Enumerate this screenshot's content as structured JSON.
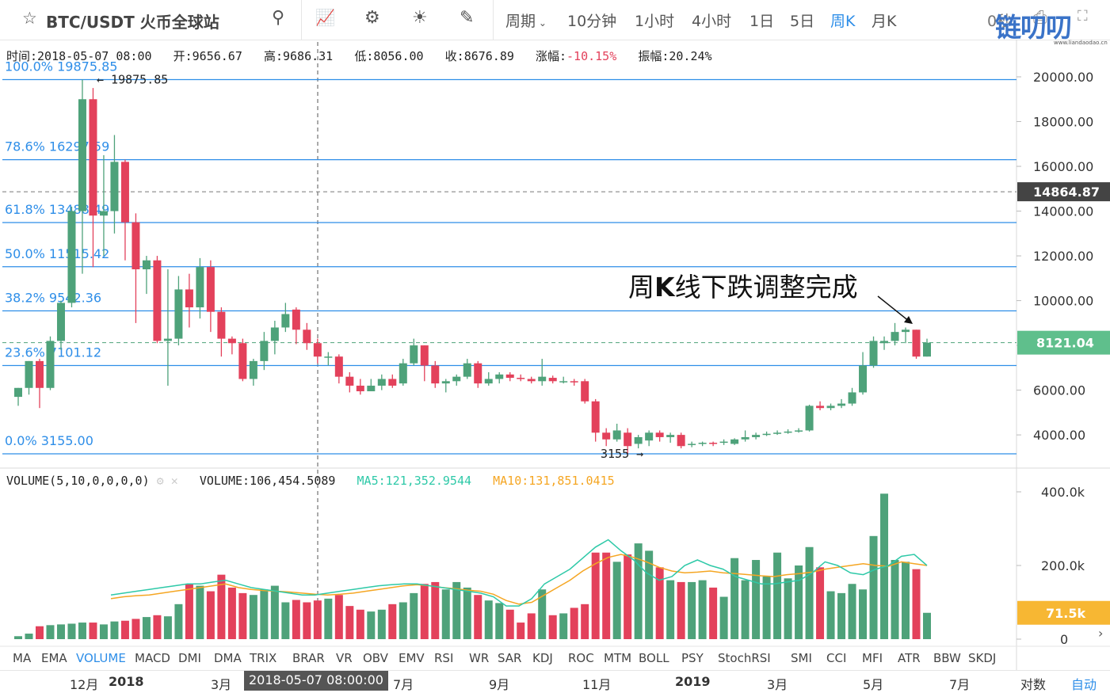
{
  "header": {
    "pair": "BTC/USDT 火币全球站",
    "icons": [
      "search-icon",
      "indicator-icon",
      "settings-icon",
      "theme-icon",
      "draw-icon",
      "screenshot-icon",
      "fullscreen-icon"
    ],
    "periods": [
      "周期",
      "10分钟",
      "1小时",
      "4小时",
      "1日",
      "5日",
      "周K",
      "月K"
    ],
    "active_period": "周K",
    "countdown": "0秒"
  },
  "info": {
    "time_label": "时间:",
    "time": "2018-05-07 08:00",
    "open_label": "开:",
    "open": "9656.67",
    "high_label": "高:",
    "high": "9686.31",
    "low_label": "低:",
    "low": "8056.00",
    "close_label": "收:",
    "close": "8676.89",
    "change_label": "涨幅:",
    "change": "-10.15%",
    "amplitude_label": "振幅:",
    "amplitude": "20.24%"
  },
  "volume_info": {
    "title": "VOLUME(5,10,0,0,0,0)",
    "volume": "VOLUME:106,454.5089",
    "ma5": "MA5:121,352.9544",
    "ma10": "MA10:131,851.0415"
  },
  "indicators": [
    "MA",
    "EMA",
    "VOLUME",
    "MACD",
    "DMI",
    "DMA",
    "TRIX",
    "BRAR",
    "VR",
    "OBV",
    "EMV",
    "RSI",
    "WR",
    "SAR",
    "KDJ",
    "ROC",
    "MTM",
    "BOLL",
    "PSY",
    "StochRSI",
    "SMI",
    "CCI",
    "MFI",
    "ATR",
    "BBW",
    "SKDJ"
  ],
  "active_indicator": "VOLUME",
  "time_axis": {
    "labels": [
      "12月",
      "2018",
      "3月",
      "7月",
      "9月",
      "11月",
      "2019",
      "3月",
      "5月",
      "7月"
    ],
    "crosshair_time": "2018-05-07 08:00:00",
    "log_button": "对数",
    "auto_button": "自动"
  },
  "watermark": {
    "text": "链叨叨",
    "sub": "www.liandaodao.cn"
  },
  "annotation": {
    "pre": "周",
    "bold": "K",
    "post": "线下跌调整完成"
  },
  "colors": {
    "up": "#4ea27a",
    "down": "#e3415b",
    "fib": "#2e8ee8",
    "ma5": "#2ec9a8",
    "ma10": "#f5a623",
    "price_tag": "#5fbf8c"
  },
  "chart_data": [
    {
      "type": "candlestick",
      "interval": "1 week",
      "ylim": [
        3155,
        20000
      ],
      "yticks": [
        4000,
        6000,
        8000,
        10000,
        12000,
        14000,
        16000,
        18000,
        20000
      ],
      "ytick_labels": [
        "4000.00",
        "6000.00",
        "8000.00",
        "10000.00",
        "12000.00",
        "14000.00",
        "16000.00",
        "18000.00",
        "20000.00"
      ],
      "last_price": "8121.04",
      "crosshair_price": "14864.87",
      "high_marker": "19875.85",
      "low_marker": "3155",
      "fib_levels": [
        {
          "label": "100.0% 19875.85",
          "value": 19875.85
        },
        {
          "label": "78.6% 16297.59",
          "value": 16297.59
        },
        {
          "label": "61.8% 13488.49",
          "value": 13488.49
        },
        {
          "label": "50.0% 11515.42",
          "value": 11515.42
        },
        {
          "label": "38.2% 9542.36",
          "value": 9542.36
        },
        {
          "label": "23.6% 7101.12",
          "value": 7101.12
        },
        {
          "label": "0.0% 3155.00",
          "value": 3155.0
        }
      ],
      "candles": [
        [
          5700,
          6100,
          5300,
          6100
        ],
        [
          6100,
          7300,
          5800,
          7300
        ],
        [
          7300,
          6100,
          5200,
          7400
        ],
        [
          6100,
          8200,
          6000,
          8400
        ],
        [
          8200,
          9900,
          7800,
          10000
        ],
        [
          9900,
          14000,
          9700,
          14200
        ],
        [
          14000,
          19000,
          11200,
          19875.85
        ],
        [
          19000,
          13800,
          11500,
          19500
        ],
        [
          13800,
          14000,
          12000,
          16500
        ],
        [
          14000,
          16200,
          13000,
          17400
        ],
        [
          16200,
          13500,
          11800,
          16300
        ],
        [
          13500,
          11400,
          9000,
          13900
        ],
        [
          11400,
          11800,
          10300,
          12000
        ],
        [
          11800,
          8200,
          8100,
          12000
        ],
        [
          8200,
          8300,
          6200,
          11400
        ],
        [
          8300,
          10500,
          8000,
          11100
        ],
        [
          10500,
          9700,
          8800,
          11200
        ],
        [
          9700,
          11500,
          9200,
          11900
        ],
        [
          11500,
          9500,
          8600,
          11800
        ],
        [
          9500,
          8300,
          7500,
          9700
        ],
        [
          8300,
          8100,
          7600,
          8400
        ],
        [
          8100,
          6500,
          6400,
          8300
        ],
        [
          6500,
          7300,
          6200,
          7400
        ],
        [
          7300,
          8200,
          6900,
          8600
        ],
        [
          8200,
          8800,
          7600,
          9100
        ],
        [
          8800,
          9400,
          8600,
          9900
        ],
        [
          9600,
          8700,
          8056,
          9700
        ],
        [
          8700,
          8100,
          7800,
          9000
        ],
        [
          8100,
          7500,
          7200,
          8300
        ],
        [
          7500,
          7500,
          7100,
          7700
        ],
        [
          7500,
          6600,
          6300,
          7600
        ],
        [
          6600,
          6200,
          5900,
          6800
        ],
        [
          6200,
          5950,
          5800,
          6500
        ],
        [
          5950,
          6200,
          6000,
          6500
        ],
        [
          6200,
          6500,
          6000,
          6700
        ],
        [
          6500,
          6200,
          6100,
          6700
        ],
        [
          6300,
          7200,
          6200,
          7400
        ],
        [
          7200,
          8000,
          7100,
          8300
        ],
        [
          8000,
          7100,
          6400,
          8000
        ],
        [
          7100,
          6300,
          6100,
          7300
        ],
        [
          6300,
          6400,
          5900,
          6500
        ],
        [
          6400,
          6600,
          6200,
          6700
        ],
        [
          6600,
          7200,
          6500,
          7400
        ],
        [
          7200,
          6300,
          6100,
          7300
        ],
        [
          6300,
          6500,
          6200,
          6800
        ],
        [
          6500,
          6700,
          6300,
          6800
        ],
        [
          6700,
          6550,
          6400,
          6800
        ],
        [
          6550,
          6500,
          6400,
          6700
        ],
        [
          6500,
          6400,
          6300,
          6600
        ],
        [
          6400,
          6600,
          6200,
          7400
        ],
        [
          6550,
          6400,
          6300,
          6650
        ],
        [
          6400,
          6400,
          6300,
          6600
        ],
        [
          6400,
          6350,
          6200,
          6500
        ],
        [
          6400,
          5500,
          5400,
          6500
        ],
        [
          5500,
          4100,
          3700,
          5600
        ],
        [
          4100,
          3800,
          3500,
          4300
        ],
        [
          3800,
          4200,
          3700,
          4500
        ],
        [
          4100,
          3500,
          3155,
          4300
        ],
        [
          3600,
          3900,
          3400,
          4000
        ],
        [
          3750,
          4100,
          3500,
          4200
        ],
        [
          4100,
          3900,
          3700,
          4200
        ],
        [
          3900,
          4000,
          3650,
          4100
        ],
        [
          4000,
          3500,
          3400,
          4100
        ],
        [
          3550,
          3600,
          3450,
          3700
        ],
        [
          3600,
          3650,
          3500,
          3700
        ],
        [
          3650,
          3600,
          3500,
          3700
        ],
        [
          3700,
          3700,
          3550,
          3800
        ],
        [
          3600,
          3800,
          3550,
          3850
        ],
        [
          3800,
          3900,
          3700,
          4200
        ],
        [
          3900,
          4000,
          3800,
          4100
        ],
        [
          4000,
          4050,
          3950,
          4150
        ],
        [
          4050,
          4100,
          4000,
          4200
        ],
        [
          4100,
          4150,
          4050,
          4250
        ],
        [
          4150,
          4200,
          4100,
          4300
        ],
        [
          4200,
          5300,
          4150,
          5350
        ],
        [
          5300,
          5200,
          5100,
          5500
        ],
        [
          5200,
          5300,
          5100,
          5400
        ],
        [
          5300,
          5400,
          5200,
          5600
        ],
        [
          5400,
          5900,
          5300,
          6100
        ],
        [
          5900,
          7100,
          5800,
          7700
        ],
        [
          7100,
          8200,
          7000,
          8400
        ],
        [
          8100,
          8200,
          7800,
          8400
        ],
        [
          8200,
          8600,
          8000,
          9000
        ],
        [
          8600,
          8700,
          8100,
          8800
        ],
        [
          8700,
          7500,
          7400,
          8700
        ],
        [
          7500,
          8121.04,
          7500,
          8300
        ]
      ],
      "volume_ylim": [
        0,
        400000
      ],
      "volume_yticks": [
        "0",
        "200.0k",
        "400.0k"
      ],
      "volume_last": "71.5k",
      "volumes": [
        8000,
        15000,
        35000,
        38000,
        40000,
        42000,
        45000,
        45000,
        40000,
        48000,
        50000,
        55000,
        60000,
        65000,
        62000,
        95000,
        150000,
        145000,
        130000,
        175000,
        140000,
        125000,
        120000,
        135000,
        145000,
        100000,
        106454,
        100000,
        105000,
        110000,
        120000,
        90000,
        80000,
        75000,
        80000,
        95000,
        100000,
        125000,
        150000,
        155000,
        135000,
        155000,
        140000,
        120000,
        105000,
        98000,
        80000,
        45000,
        70000,
        135000,
        65000,
        70000,
        85000,
        95000,
        235000,
        235000,
        210000,
        230000,
        260000,
        240000,
        195000,
        160000,
        155000,
        155000,
        160000,
        140000,
        115000,
        220000,
        160000,
        215000,
        170000,
        235000,
        165000,
        200000,
        250000,
        195000,
        130000,
        125000,
        150000,
        135000,
        280000,
        395000,
        215000,
        210000,
        190000,
        71500
      ],
      "ma5": [
        120000,
        125000,
        130000,
        135000,
        140000,
        145000,
        150000,
        150000,
        155000,
        160000,
        150000,
        140000,
        135000,
        130000,
        125000,
        120000,
        120000,
        125000,
        130000,
        135000,
        140000,
        145000,
        148000,
        150000,
        150000,
        145000,
        140000,
        135000,
        130000,
        125000,
        115000,
        90000,
        90000,
        110000,
        150000,
        170000,
        190000,
        220000,
        250000,
        270000,
        240000,
        215000,
        180000,
        160000,
        170000,
        200000,
        215000,
        200000,
        190000,
        170000,
        160000,
        150000,
        150000,
        155000,
        160000,
        180000,
        210000,
        200000,
        180000,
        175000,
        190000,
        200000,
        225000,
        230000,
        200000
      ],
      "ma10": [
        110000,
        115000,
        118000,
        120000,
        125000,
        130000,
        135000,
        140000,
        145000,
        150000,
        140000,
        135000,
        132000,
        130000,
        128000,
        125000,
        122000,
        120000,
        122000,
        125000,
        130000,
        135000,
        140000,
        145000,
        148000,
        145000,
        140000,
        137000,
        133000,
        130000,
        122000,
        105000,
        95000,
        100000,
        120000,
        140000,
        160000,
        185000,
        205000,
        222000,
        230000,
        222000,
        210000,
        195000,
        185000,
        180000,
        182000,
        185000,
        180000,
        178000,
        175000,
        172000,
        170000,
        175000,
        178000,
        182000,
        190000,
        195000,
        200000,
        205000,
        200000,
        198000,
        210000,
        205000,
        200000
      ]
    }
  ]
}
